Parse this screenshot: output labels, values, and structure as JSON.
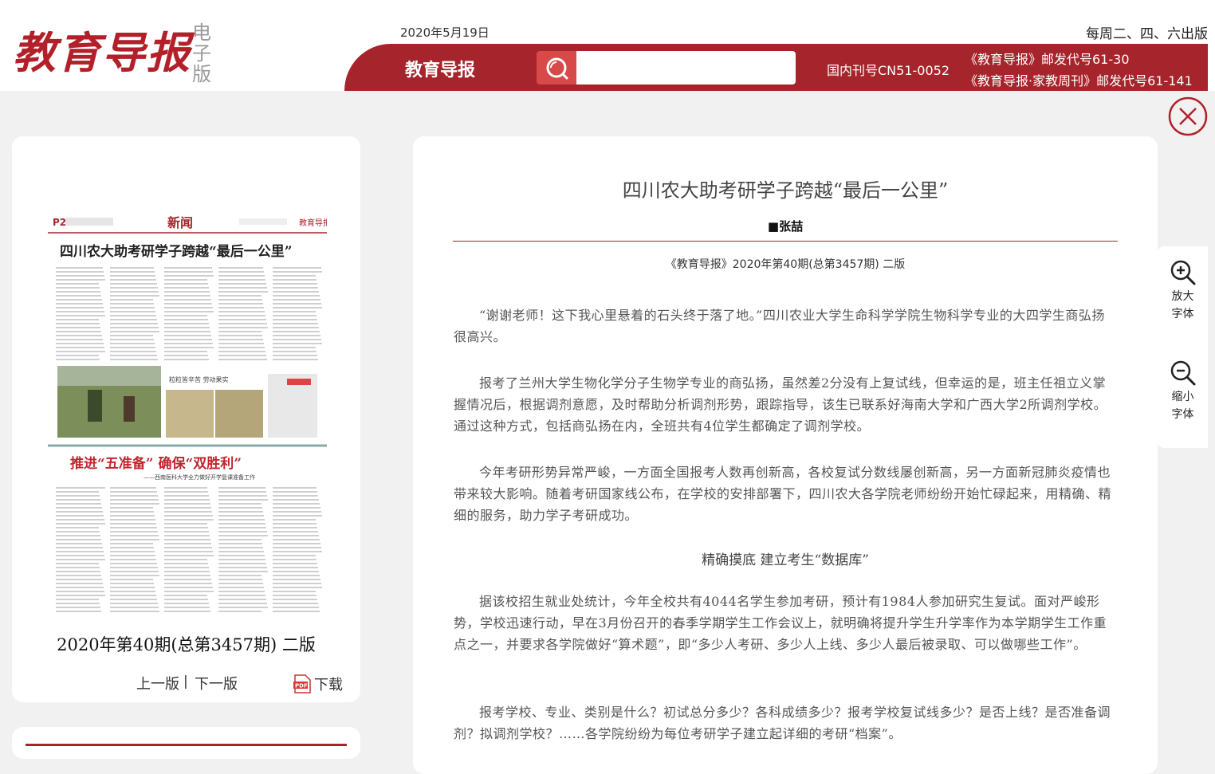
{
  "header": {
    "logo_main": "教育导报",
    "logo_sub": "电子版",
    "date": "2020年5月19日",
    "schedule": "每周二、四、六出版",
    "bar_title": "教育导报",
    "search": {
      "placeholder": ""
    },
    "issn": "国内刊号CN51-0052",
    "postal_1": "《教育导报》邮发代号61-30",
    "postal_2": "《教育导报·家教周刊》邮发代号61-141"
  },
  "sidebar": {
    "issue_label": "2020年第40期(总第3457期)  二版",
    "prev_label": "上一版",
    "separator": "|",
    "next_label": "下一版",
    "pdf_badge": "PDF",
    "download_label": "下载",
    "thumbnail": {
      "section": "新闻",
      "masthead": "教育导报",
      "headline_1": "四川农大助考研学子跨越“最后一公里”",
      "photo_caption": "粒粒皆辛苦  劳动果实",
      "headline_2": "推进“五准备”  确保“双胜利”",
      "subline_2": "——西南医科大学全力做好开学复课准备工作"
    }
  },
  "article": {
    "title": "四川农大助考研学子跨越“最后一公里”",
    "author": "■张喆",
    "source": "《教育导报》2020年第40期(总第3457期) 二版",
    "paragraphs": [
      "“谢谢老师！这下我心里悬着的石头终于落了地。”四川农业大学生命科学学院生物科学专业的大四学生商弘扬很高兴。",
      "报考了兰州大学生物化学分子生物学专业的商弘扬，虽然差2分没有上复试线，但幸运的是，班主任祖立义掌握情况后，根据调剂意愿，及时帮助分析调剂形势，跟踪指导，该生已联系好海南大学和广西大学2所调剂学校。通过这种方式，包括商弘扬在内，全班共有4位学生都确定了调剂学校。",
      "今年考研形势异常严峻，一方面全国报考人数再创新高，各校复试分数线屡创新高，另一方面新冠肺炎疫情也带来较大影响。随着考研国家线公布，在学校的安排部署下，四川农大各学院老师纷纷开始忙碌起来，用精确、精细的服务，助力学子考研成功。",
      "据该校招生就业处统计，今年全校共有4044名学生参加考研，预计有1984人参加研究生复试。面对严峻形势，学校迅速行动，早在3月份召开的春季学期学生工作会议上，就明确将提升学生升学率作为本学期学生工作重点之一，并要求各学院做好“算术题”，即“多少人考研、多少人上线、多少人最后被录取、可以做哪些工作”。",
      "报考学校、专业、类别是什么？初试总分多少？各科成绩多少？报考学校复试线多少？是否上线？是否准备调剂？拟调剂学校？……各学院纷纷为每位考研学子建立起详细的考研“档案”。"
    ],
    "subheading": "精确摸底 建立考生“数据库”"
  },
  "tools": {
    "zoom_in_line1": "放大",
    "zoom_in_line2": "字体",
    "zoom_out_line1": "缩小",
    "zoom_out_line2": "字体"
  },
  "colors": {
    "brand_red": "#a6242b",
    "search_red": "#d84a4a"
  },
  "icons": [
    "search-icon",
    "close-icon",
    "pdf-icon",
    "zoom-in-icon",
    "zoom-out-icon"
  ]
}
